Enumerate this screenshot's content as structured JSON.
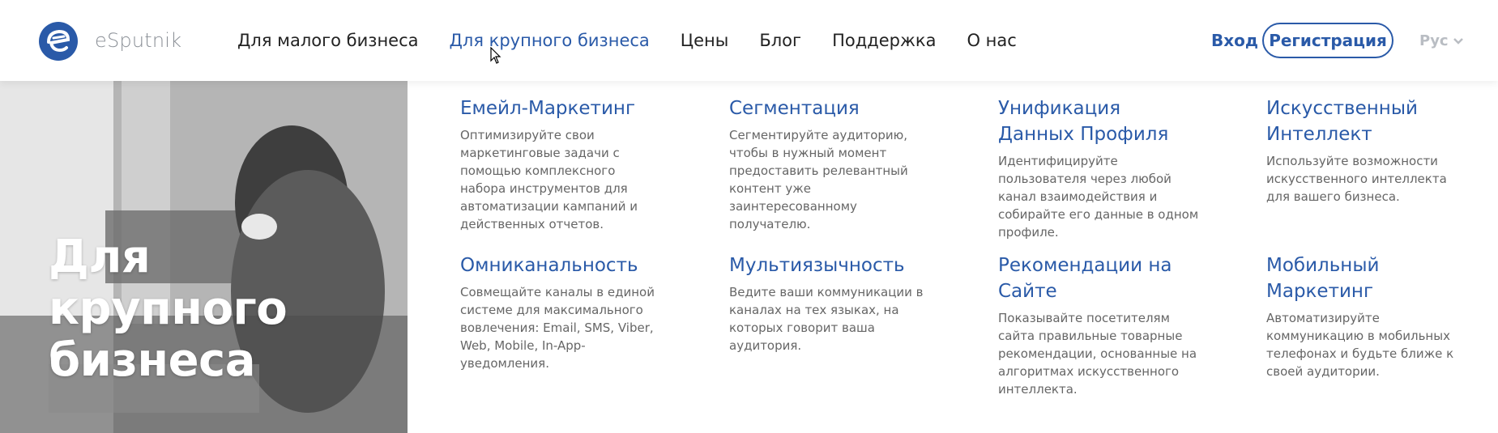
{
  "brand": {
    "name": "eSputnik",
    "logo_color": "#2a5aa8"
  },
  "nav": {
    "items": [
      {
        "label": "Для малого бизнеса",
        "active": false
      },
      {
        "label": "Для крупного бизнеса",
        "active": true
      },
      {
        "label": "Цены",
        "active": false
      },
      {
        "label": "Блог",
        "active": false
      },
      {
        "label": "Поддержка",
        "active": false
      },
      {
        "label": "О нас",
        "active": false
      }
    ],
    "login_label": "Вход",
    "register_label": "Регистрация",
    "language_label": "Рус",
    "accent_color": "#2a5aa8"
  },
  "hero": {
    "title_line1": "Для",
    "title_line2": "крупного",
    "title_line3": "бизнеса"
  },
  "menu": {
    "items": [
      {
        "title": "Емейл-Маркетинг",
        "desc": "Оптимизируйте свои маркетинговые задачи с помощью комплексного набора инструментов для автоматизации кампаний и действенных отчетов."
      },
      {
        "title": "Сегментация",
        "desc": "Сегментируйте аудиторию, чтобы в нужный момент предоставить релевантный контент уже заинтересованному получателю."
      },
      {
        "title": "Унификация Данных Профиля",
        "desc": "Идентифицируйте пользователя через любой канал взаимодействия и собирайте его данные в одном профиле."
      },
      {
        "title": "Искусственный Интеллект",
        "desc": "Используйте возможности искусственного интеллекта для вашего бизнеса."
      },
      {
        "title": "Омниканальность",
        "desc": "Совмещайте каналы в единой системе для максимального вовлечения: Email, SMS, Viber, Web, Mobile, In-App-уведомления."
      },
      {
        "title": "Мультиязычность",
        "desc": "Ведите ваши коммуникации в каналах на тех языках, на которых говорит ваша аудитория."
      },
      {
        "title": "Рекомендации на Сайте",
        "desc": "Показывайте посетителям сайта правильные товарные рекомендации, основанные на алгоритмах искусственного интеллекта."
      },
      {
        "title": "Мобильный Маркетинг",
        "desc": "Автоматизируйте коммуникацию в мобильных телефонах и будьте ближе к своей аудитории."
      }
    ]
  }
}
